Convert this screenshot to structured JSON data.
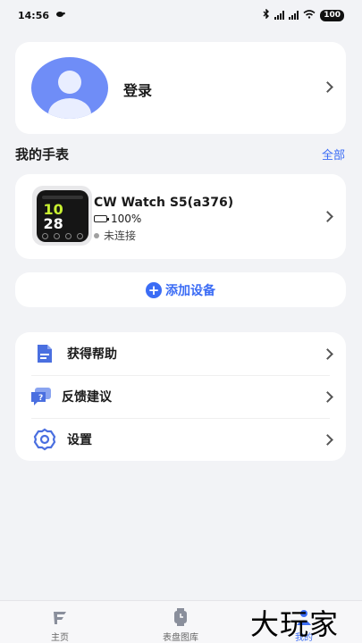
{
  "status_bar": {
    "time": "14:56",
    "battery": "100"
  },
  "profile": {
    "login_label": "登录"
  },
  "my_watches": {
    "title": "我的手表",
    "all_link": "全部",
    "device": {
      "name": "CW Watch S5(a376)",
      "battery": "100%",
      "battery_level": 1.0,
      "connection": "未连接",
      "face_time": "10",
      "face_time2": "28"
    }
  },
  "add_device": {
    "label": "添加设备"
  },
  "menu": {
    "items": [
      {
        "label": "获得帮助",
        "icon": "document-icon"
      },
      {
        "label": "反馈建议",
        "icon": "feedback-icon"
      },
      {
        "label": "设置",
        "icon": "gear-icon"
      }
    ]
  },
  "tabbar": {
    "tabs": [
      {
        "label": "主页",
        "icon": "home-icon"
      },
      {
        "label": "表盘图库",
        "icon": "watch-icon"
      },
      {
        "label": "我的",
        "icon": "profile-icon"
      }
    ]
  },
  "watermark": "大玩家",
  "colors": {
    "accent": "#3b6cf5",
    "background": "#f2f3f6",
    "avatar": "#6f8df7"
  }
}
